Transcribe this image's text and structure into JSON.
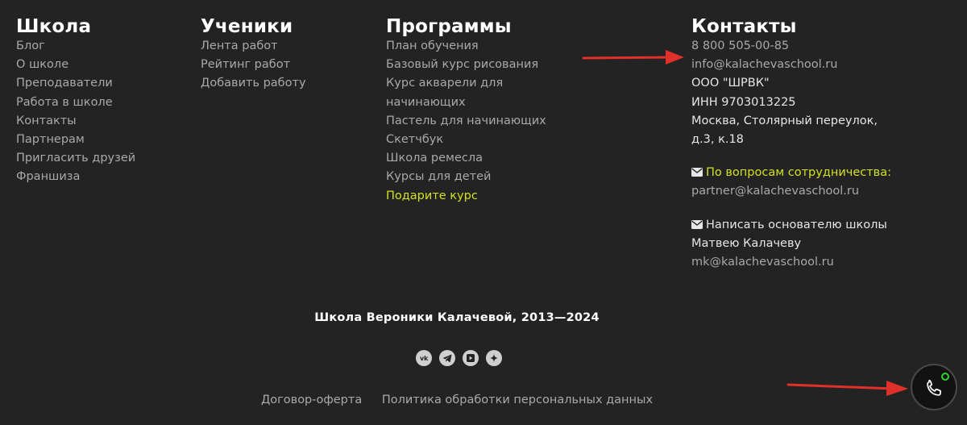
{
  "footer": {
    "school": {
      "heading": "Школа",
      "links": [
        "Блог",
        "О школе",
        "Преподаватели",
        "Работа в школе",
        "Контакты",
        "Партнерам",
        "Пригласить друзей",
        "Франшиза"
      ]
    },
    "students": {
      "heading": "Ученики",
      "links": [
        "Лента работ",
        "Рейтинг работ",
        "Добавить работу"
      ]
    },
    "programs": {
      "heading": "Программы",
      "links": [
        "План обучения",
        "Базовый курс рисования",
        "Курс акварели для начинающих",
        "Пастель для начинающих",
        "Скетчбук",
        "Школа ремесла",
        "Курсы для детей"
      ],
      "gift_link": "Подарите курс"
    },
    "contacts": {
      "heading": "Контакты",
      "phone": "8 800 505-00-85",
      "email": "info@kalachevaschool.ru",
      "company": "ООО \"ШРВК\"",
      "inn": "ИНН 9703013225",
      "address_line1": "Москва, Столярный переулок,",
      "address_line2": "д.3, к.18",
      "partnership_label": "По вопросам сотрудничества:",
      "partnership_email": "partner@kalachevaschool.ru",
      "founder_label_line1": "Написать основателю школы",
      "founder_label_line2": "Матвею Калачеву",
      "founder_email": "mk@kalachevaschool.ru"
    },
    "copyright": "Школа Вероники Калачевой, 2013—2024",
    "socials": [
      {
        "icon": "vk-icon",
        "glyph": "vk"
      },
      {
        "icon": "telegram-icon"
      },
      {
        "icon": "youtube-icon"
      },
      {
        "icon": "dzen-icon"
      }
    ],
    "legal": {
      "offer": "Договор-оферта",
      "privacy": "Политика обработки персональных данных"
    }
  },
  "colors": {
    "background": "#232323",
    "accent": "#d4e021",
    "arrow": "#e0302a",
    "status": "#2fd52f"
  }
}
